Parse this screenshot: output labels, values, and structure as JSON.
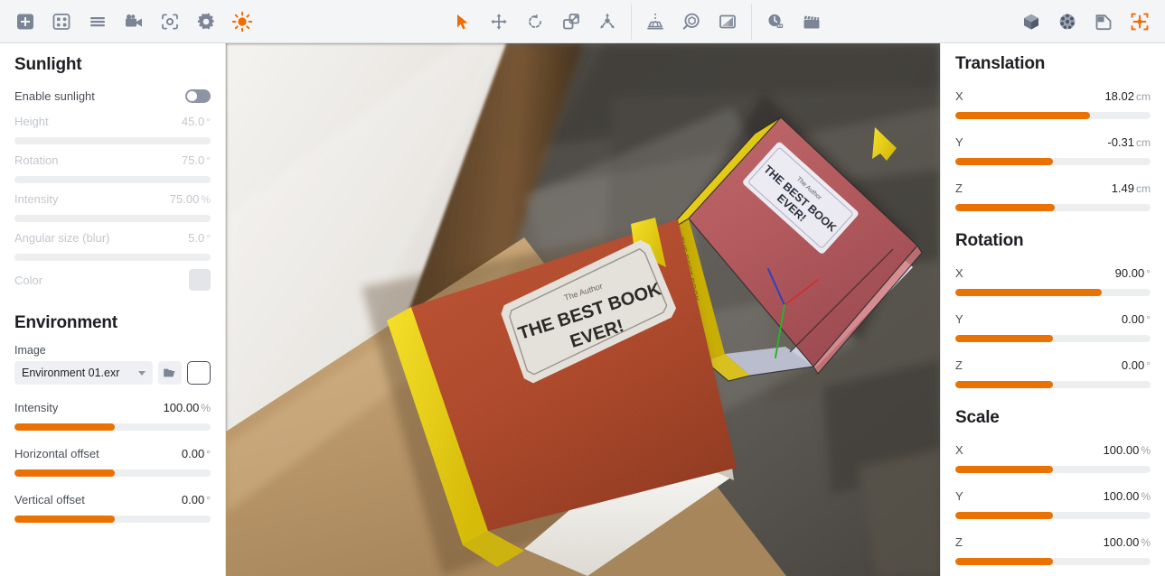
{
  "toolbar": {
    "left_group": [
      {
        "name": "add-object-icon",
        "label": "Add"
      },
      {
        "name": "scene-grid-icon",
        "label": "Scene"
      },
      {
        "name": "list-menu-icon",
        "label": "List"
      },
      {
        "name": "camera-icon",
        "label": "Camera"
      },
      {
        "name": "snapshot-icon",
        "label": "Snapshot"
      },
      {
        "name": "settings-gear-icon",
        "label": "Settings"
      },
      {
        "name": "sunlight-icon",
        "label": "Sunlight",
        "active": true
      }
    ],
    "transform_group": [
      {
        "name": "select-cursor-icon",
        "label": "Select",
        "active": true
      },
      {
        "name": "move-icon",
        "label": "Move"
      },
      {
        "name": "rotate-icon",
        "label": "Rotate"
      },
      {
        "name": "scale-icon",
        "label": "Scale"
      },
      {
        "name": "explode-icon",
        "label": "Explode"
      }
    ],
    "tools_group": [
      {
        "name": "measure-icon",
        "label": "Measure"
      },
      {
        "name": "inspect-icon",
        "label": "Inspect"
      },
      {
        "name": "gradient-icon",
        "label": "Gradient"
      }
    ],
    "time_group": [
      {
        "name": "timeline-icon",
        "label": "Timeline"
      },
      {
        "name": "animation-clapper-icon",
        "label": "Animation"
      }
    ],
    "right_group": [
      {
        "name": "cube-shaded-icon",
        "label": "Shaded"
      },
      {
        "name": "sphere-checker-icon",
        "label": "Material"
      },
      {
        "name": "render-page-icon",
        "label": "Render"
      },
      {
        "name": "fit-view-icon",
        "label": "Fit view",
        "active": true
      }
    ]
  },
  "sunlight": {
    "title": "Sunlight",
    "enable_label": "Enable sunlight",
    "enabled": false,
    "params": [
      {
        "label": "Height",
        "value": "45.0",
        "unit": "°",
        "fill": 0
      },
      {
        "label": "Rotation",
        "value": "75.0",
        "unit": "°",
        "fill": 0
      },
      {
        "label": "Intensity",
        "value": "75.00",
        "unit": "%",
        "fill": 0
      },
      {
        "label": "Angular size (blur)",
        "value": "5.0",
        "unit": "°",
        "fill": 0
      }
    ],
    "color_label": "Color",
    "color_value": "#e3e5e9"
  },
  "environment": {
    "title": "Environment",
    "image_label": "Image",
    "image_value": "Environment 01.exr",
    "browse_icon": "folder-open-icon",
    "preview_icon": "environment-preview-thumb",
    "params": [
      {
        "label": "Intensity",
        "value": "100.00",
        "unit": "%",
        "fill": 51
      },
      {
        "label": "Horizontal offset",
        "value": "0.00",
        "unit": "°",
        "fill": 51
      },
      {
        "label": "Vertical offset",
        "value": "0.00",
        "unit": "°",
        "fill": 51
      }
    ]
  },
  "transform": {
    "translation": {
      "title": "Translation",
      "axes": [
        {
          "label": "X",
          "value": "18.02",
          "unit": "cm",
          "fill": 69
        },
        {
          "label": "Y",
          "value": "-0.31",
          "unit": "cm",
          "fill": 50
        },
        {
          "label": "Z",
          "value": "1.49",
          "unit": "cm",
          "fill": 51
        }
      ]
    },
    "rotation": {
      "title": "Rotation",
      "axes": [
        {
          "label": "X",
          "value": "90.00",
          "unit": "°",
          "fill": 75
        },
        {
          "label": "Y",
          "value": "0.00",
          "unit": "°",
          "fill": 50
        },
        {
          "label": "Z",
          "value": "0.00",
          "unit": "°",
          "fill": 50
        }
      ]
    },
    "scale": {
      "title": "Scale",
      "axes": [
        {
          "label": "X",
          "value": "100.00",
          "unit": "%",
          "fill": 50
        },
        {
          "label": "Y",
          "value": "100.00",
          "unit": "%",
          "fill": 50
        },
        {
          "label": "Z",
          "value": "100.00",
          "unit": "%",
          "fill": 50
        }
      ]
    }
  },
  "viewport": {
    "name": "3d-viewport",
    "books": [
      {
        "name": "book-front",
        "title_line1": "THE BEST BOOK",
        "title_line2": "EVER!",
        "byline": "The Author",
        "cover_color": "#b24527",
        "selected": false
      },
      {
        "name": "book-selected",
        "title_line1": "THE BEST BOOK",
        "title_line2": "EVER!",
        "byline": "The Author",
        "cover_color": "#b5565a",
        "selected": true
      }
    ],
    "gizmo": {
      "name": "axis-gizmo",
      "x_color": "#d03030",
      "y_color": "#2bb12b",
      "z_color": "#2f3fc0"
    }
  }
}
